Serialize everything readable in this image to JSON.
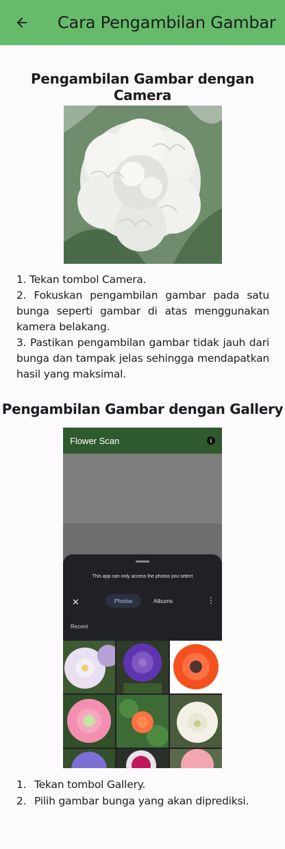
{
  "appbar": {
    "title": "Cara Pengambilan Gambar",
    "back_icon": "arrow-left-icon"
  },
  "camera_section": {
    "title": "Pengambilan Gambar dengan Camera",
    "steps": [
      "1. Tekan tombol Camera.",
      "2. Fokuskan pengambilan gambar pada satu bunga seperti gambar di atas menggunakan kamera belakang.",
      "3. Pastikan pengambilan gambar tidak jauh dari bunga dan tampak jelas sehingga mendapatkan hasil yang maksimal."
    ]
  },
  "gallery_section": {
    "title": "Pengambilan Gambar dengan Gallery",
    "screenshot": {
      "app_title": "Flower Scan",
      "notice": "This app can only access the photos you select",
      "tab_photos": "Photos",
      "tab_albums": "Albums",
      "recent_label": "Recent"
    },
    "steps": [
      {
        "num": "1.",
        "text": "Tekan tombol Gallery."
      },
      {
        "num": "2.",
        "text": "Pilih gambar bunga yang akan diprediksi."
      }
    ]
  },
  "colors": {
    "appbar": "#66bb6a",
    "background": "#fdfafe",
    "phone_bar": "#2e5a2e"
  }
}
